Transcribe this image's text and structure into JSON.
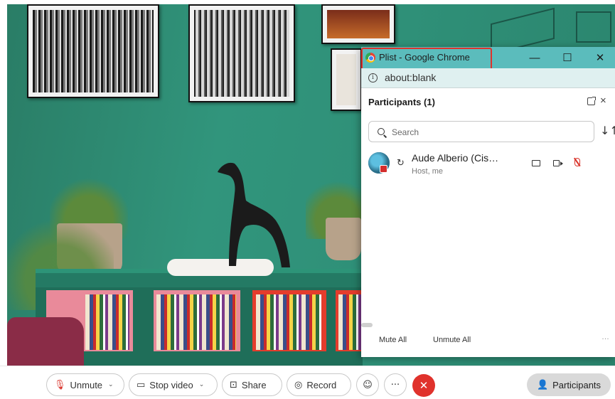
{
  "popup": {
    "window_title": "Plist - Google Chrome",
    "minimize_glyph": "—",
    "maximize_glyph": "☐",
    "close_glyph": "✕",
    "url": "about:blank",
    "info_glyph": "i"
  },
  "participants_panel": {
    "header": "Participants (1)",
    "close_glyph": "×",
    "search_placeholder": "Search",
    "sort_glyph": "↓↑",
    "participants": [
      {
        "name": "Aude Alberio (Cis…",
        "subtitle": "Host, me",
        "status_glyph": "↻"
      }
    ],
    "mute_all_label": "Mute All",
    "unmute_all_label": "Unmute All",
    "more_glyph": "…"
  },
  "toolbar": {
    "unmute_label": "Unmute",
    "unmute_icon_glyph": "🎙",
    "stop_video_label": "Stop video",
    "caret_glyph": "⌄",
    "share_label": "Share",
    "record_label": "Record",
    "reactions_glyph": "☺",
    "more_glyph": "···",
    "end_glyph": "✕",
    "participants_label": "Participants"
  },
  "colors": {
    "titlebar": "#5bbcbc",
    "highlight_border": "#e0322c",
    "end_call": "#e0322c",
    "muted_mic": "#d9342b"
  }
}
